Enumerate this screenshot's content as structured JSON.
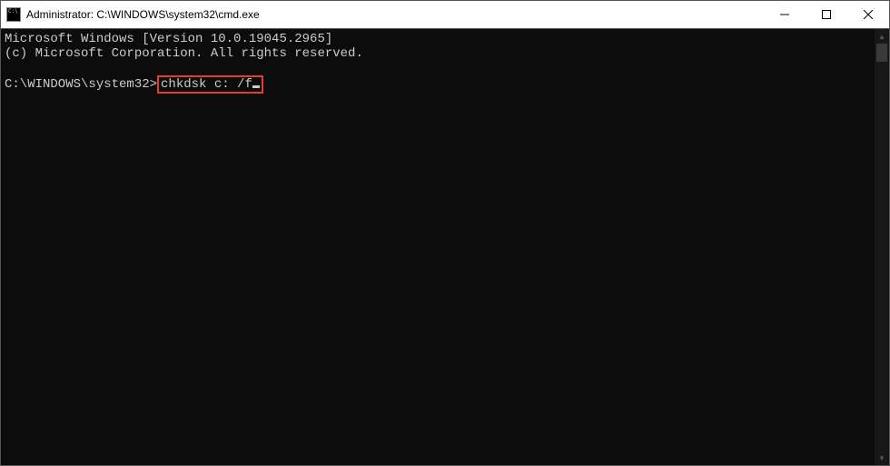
{
  "titlebar": {
    "title": "Administrator: C:\\WINDOWS\\system32\\cmd.exe"
  },
  "console": {
    "line1": "Microsoft Windows [Version 10.0.19045.2965]",
    "line2": "(c) Microsoft Corporation. All rights reserved.",
    "prompt": "C:\\WINDOWS\\system32>",
    "command": "chkdsk c: /f"
  }
}
